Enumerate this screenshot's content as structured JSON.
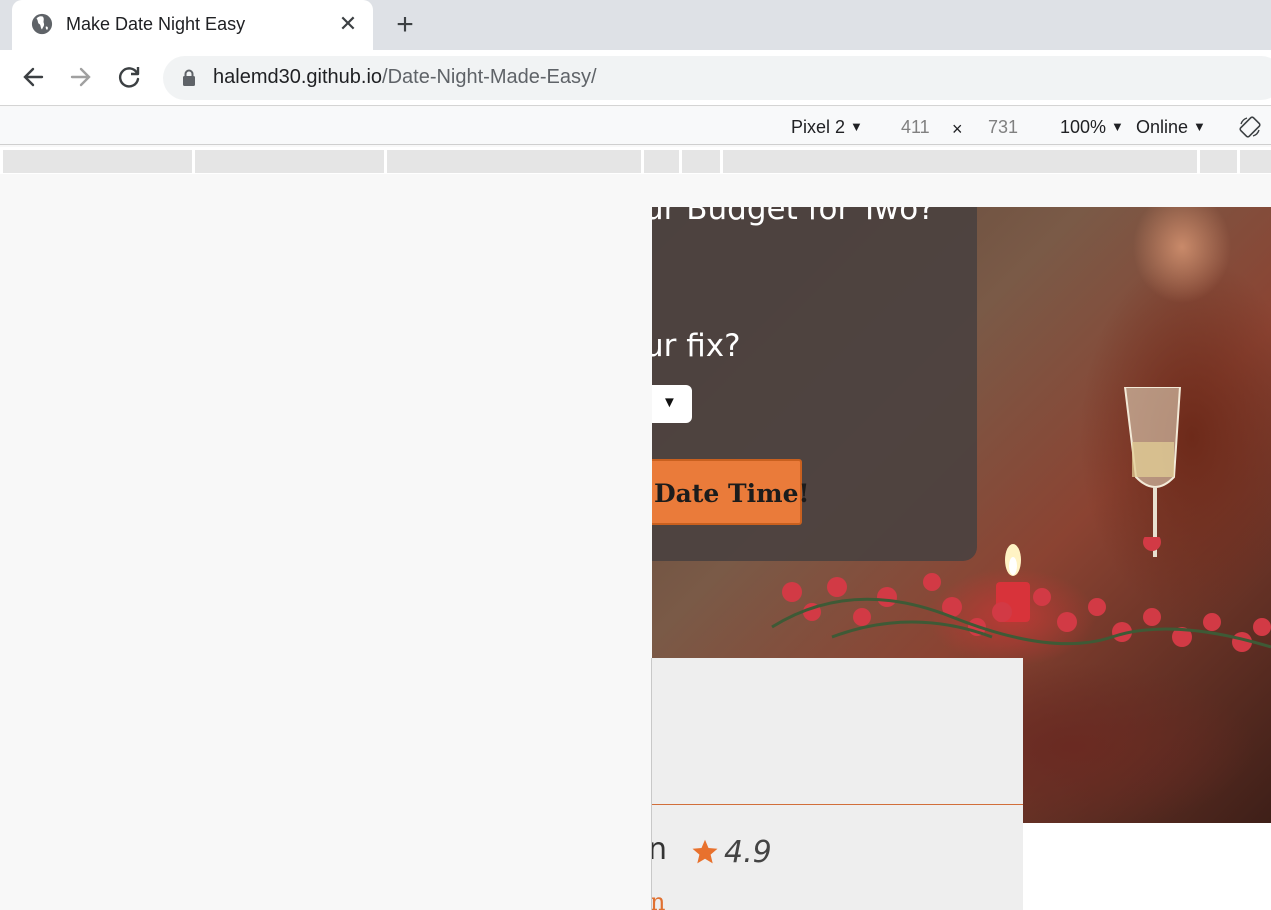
{
  "browser": {
    "tab": {
      "title": "Make Date Night Easy",
      "close_glyph": "✕",
      "icon": "globe-icon"
    },
    "new_tab_glyph": "+",
    "url": {
      "host": "halemd30.github.io",
      "path": "/Date-Night-Made-Easy/"
    }
  },
  "device_toolbar": {
    "device": "Pixel 2",
    "width": "411",
    "times": "×",
    "height": "731",
    "zoom": "100%",
    "network": "Online",
    "caret": "▼"
  },
  "page": {
    "question_budget": "ur Budget for Two?",
    "question_fix": "ur fix?",
    "select_caret": "▼",
    "submit_label": "Date Time!",
    "result": {
      "name_fragment": "n",
      "rating": "4.9",
      "link_fragment": "n"
    }
  },
  "colors": {
    "accent": "#ea7b3a",
    "panel": "#4b423f",
    "link": "#e07030"
  }
}
